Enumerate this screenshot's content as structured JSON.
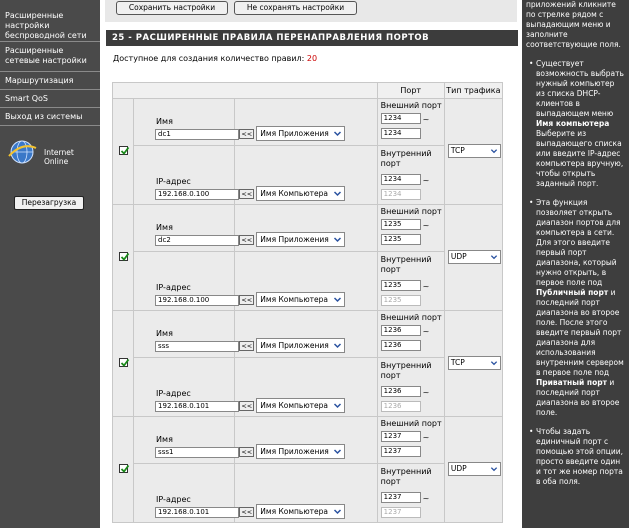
{
  "sidebar": {
    "items": [
      {
        "label": "Расширенные настройки беспроводной сети"
      },
      {
        "label": "Расширенные сетевые настройки"
      },
      {
        "label": "Маршрутизация"
      },
      {
        "label": "Smart QoS"
      },
      {
        "label": "Выход из системы"
      }
    ],
    "status": "Internet Online",
    "reboot": "Перезагрузка"
  },
  "top_buttons": {
    "save": "Сохранить настройки",
    "nosave": "Не сохранять настройки"
  },
  "section": {
    "title": "25 - РАСШИРЕННЫЕ ПРАВИЛА ПЕРЕНАПРАВЛЕНИЯ ПОРТОВ",
    "avail_label": "Доступное для создания количество правил:",
    "avail_count": "20"
  },
  "table": {
    "headers": {
      "port": "Порт",
      "traffic": "Тип трафика"
    },
    "name_label": "Имя",
    "ip_label": "IP-адрес",
    "arrow": "<<",
    "app_select": "Имя Приложения",
    "computer_select": "Имя Компьютера",
    "ext_port_label": "Внешний порт",
    "int_port_label": "Внутренний порт",
    "tilde": "~",
    "rules": [
      {
        "name": "dc1",
        "ip": "192.168.0.100",
        "ext_start": "1234",
        "ext_end": "1234",
        "int_start": "1234",
        "int_end": "1234",
        "type": "TCP"
      },
      {
        "name": "dc2",
        "ip": "192.168.0.100",
        "ext_start": "1235",
        "ext_end": "1235",
        "int_start": "1235",
        "int_end": "1235",
        "type": "UDP"
      },
      {
        "name": "sss",
        "ip": "192.168.0.101",
        "ext_start": "1236",
        "ext_end": "1236",
        "int_start": "1236",
        "int_end": "1236",
        "type": "TCP"
      },
      {
        "name": "sss1",
        "ip": "192.168.0.101",
        "ext_start": "1237",
        "ext_end": "1237",
        "int_start": "1237",
        "int_end": "1237",
        "type": "UDP"
      }
    ]
  },
  "help": {
    "p0": "приложений кликните по стрелке рядом с выпадающим меню и заполните соответствующие поля.",
    "p1_a": "Существует возможность выбрать нужный компьютер из списка DHCP-клиентов в выпадающем меню ",
    "p1_b": "Имя компьютера",
    "p1_c": " Выберите из выпадающего списка или введите IP-адрес компьютера вручную, чтобы открыть заданный порт.",
    "p2_a": "Эта функция позволяет открыть диапазон портов для компьютера в сети. Для этого введите первый порт диапазона, который нужно открыть, в первое поле под ",
    "p2_b": "Публичный порт",
    "p2_c": " и последний порт диапазона во второе поле. После этого введите первый порт диапазона для использования внутренним сервером в первое поле под ",
    "p2_d": "Приватный порт",
    "p2_e": " и последний порт диапазона во второе поле.",
    "p3": "Чтобы задать единичный порт с помощью этой опции, просто введите один и тот же номер порта в оба поля."
  }
}
